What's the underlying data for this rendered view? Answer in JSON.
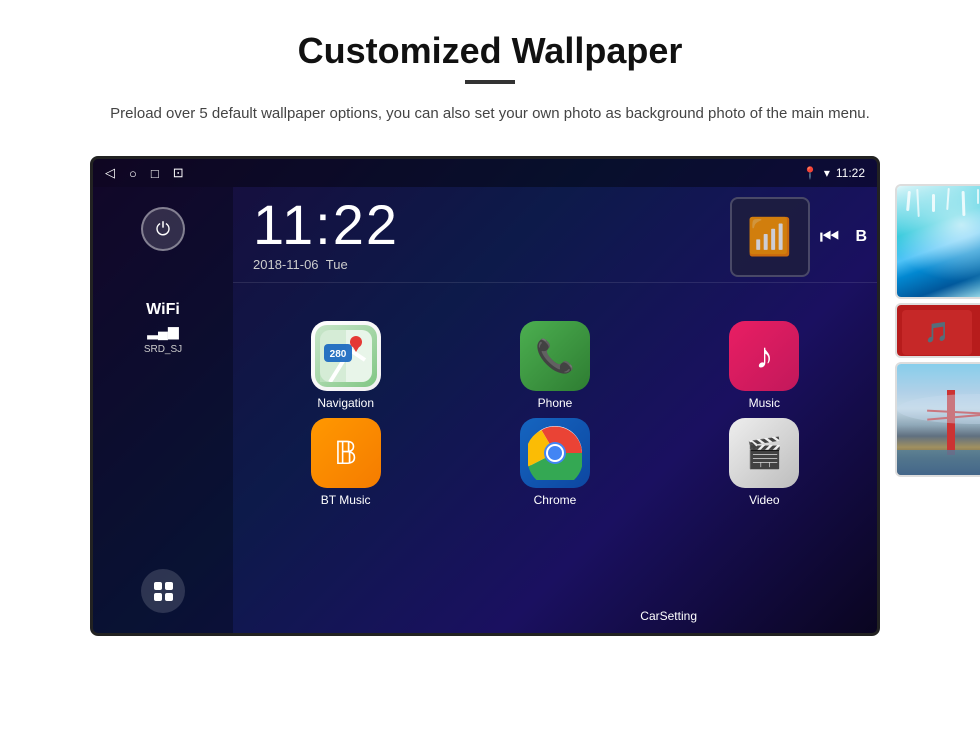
{
  "page": {
    "title": "Customized Wallpaper",
    "subtitle": "Preload over 5 default wallpaper options, you can also set your own photo as background photo of the main menu."
  },
  "screen": {
    "time": "11:22",
    "date": "2018-11-06",
    "day": "Tue",
    "wifi_label": "WiFi",
    "wifi_ssid": "SRD_SJ",
    "status_time": "11:22"
  },
  "apps": [
    {
      "name": "Navigation",
      "type": "navigation"
    },
    {
      "name": "Phone",
      "type": "phone"
    },
    {
      "name": "Music",
      "type": "music"
    },
    {
      "name": "BT Music",
      "type": "bt-music"
    },
    {
      "name": "Chrome",
      "type": "chrome"
    },
    {
      "name": "Video",
      "type": "video"
    }
  ],
  "wallpapers": [
    {
      "name": "Ice Blue",
      "type": "ice"
    },
    {
      "name": "Music Player",
      "type": "player"
    },
    {
      "name": "Bridge",
      "type": "bridge"
    }
  ],
  "labels": {
    "carsetting": "CarSetting"
  }
}
